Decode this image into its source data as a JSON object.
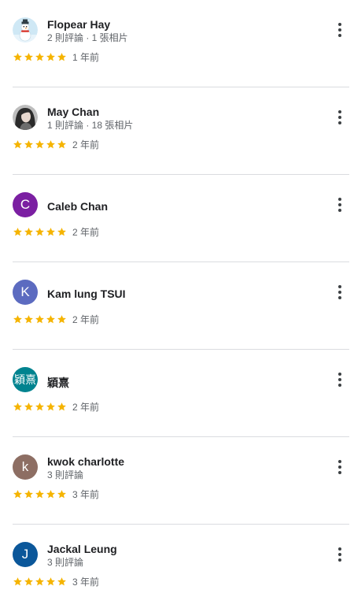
{
  "colors": {
    "star": "#f5b400",
    "divider": "#dadce0",
    "secondary_text": "#5f6368"
  },
  "reviews": [
    {
      "name": "Flopear Hay",
      "meta": "2 則評論 · 1 張相片",
      "rating": 5,
      "time": "1 年前",
      "avatar": {
        "type": "photo",
        "icon": "snowman-photo",
        "color": "#cfe8f5"
      }
    },
    {
      "name": "May Chan",
      "meta": "1 則評論 · 18 張相片",
      "rating": 5,
      "time": "2 年前",
      "avatar": {
        "type": "photo",
        "icon": "person-photo",
        "color": "#9e9e9e"
      }
    },
    {
      "name": "Caleb Chan",
      "meta": "",
      "rating": 5,
      "time": "2 年前",
      "avatar": {
        "type": "letter",
        "letter": "C",
        "color": "#7b1fa2"
      }
    },
    {
      "name": "Kam lung TSUI",
      "meta": "",
      "rating": 5,
      "time": "2 年前",
      "avatar": {
        "type": "letter",
        "letter": "K",
        "color": "#5c6bc0"
      }
    },
    {
      "name": "穎熹",
      "meta": "",
      "rating": 5,
      "time": "2 年前",
      "avatar": {
        "type": "letter",
        "letter": "穎熹",
        "color": "#00838f"
      }
    },
    {
      "name": "kwok charlotte",
      "meta": "3 則評論",
      "rating": 5,
      "time": "3 年前",
      "avatar": {
        "type": "letter",
        "letter": "k",
        "color": "#8d6e63"
      }
    },
    {
      "name": "Jackal Leung",
      "meta": "3 則評論",
      "rating": 5,
      "time": "3 年前",
      "avatar": {
        "type": "letter",
        "letter": "J",
        "color": "#0b579a"
      }
    }
  ]
}
